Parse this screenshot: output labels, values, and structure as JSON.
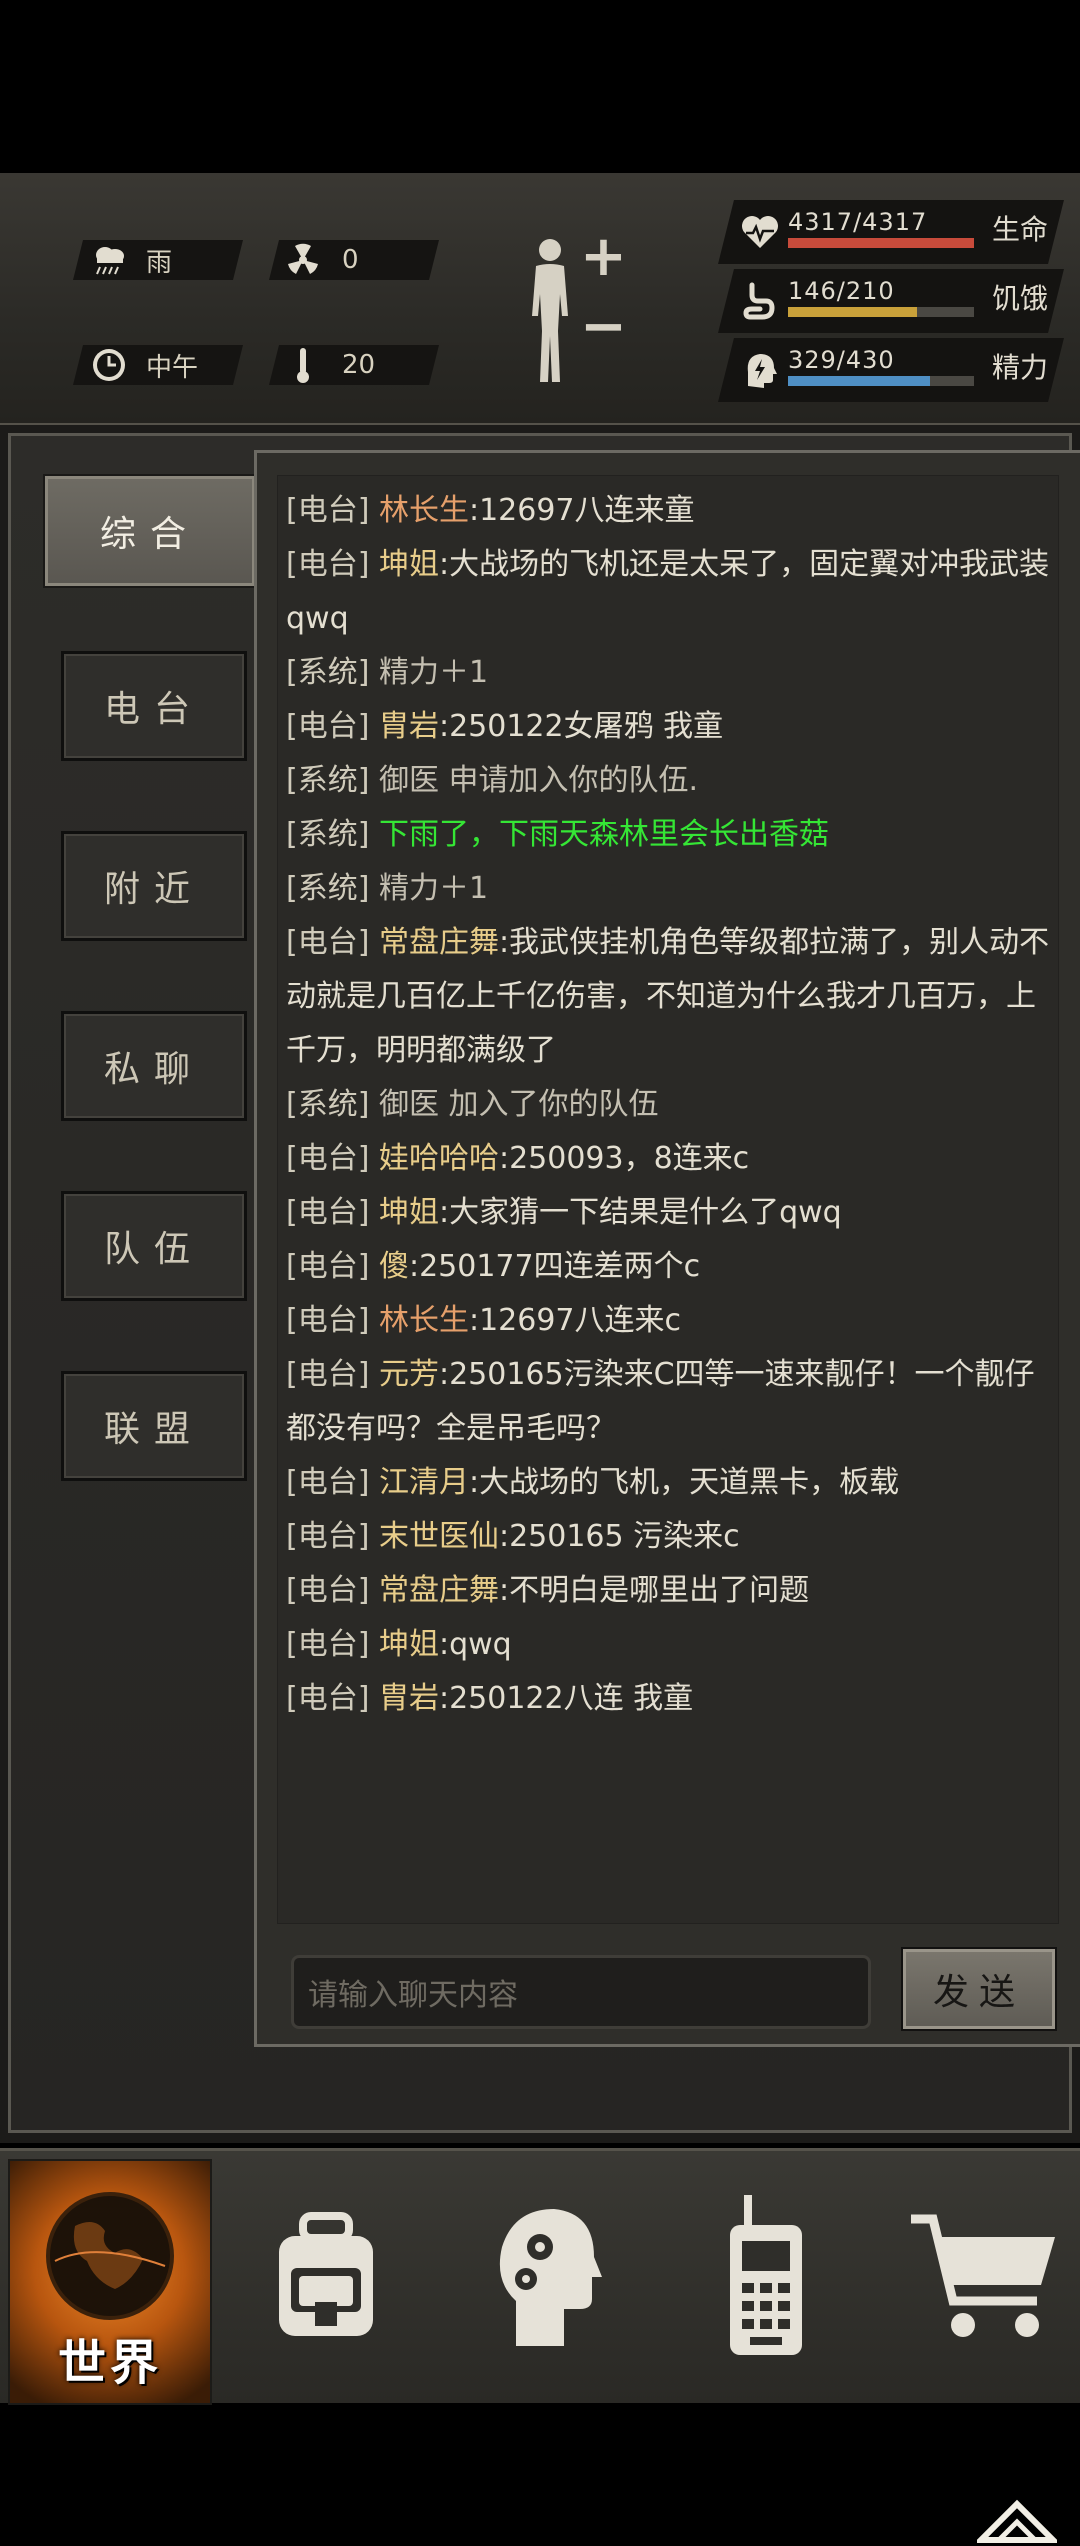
{
  "hud": {
    "weather": {
      "icon": "rain-cloud-icon",
      "label": "雨"
    },
    "radiation": {
      "icon": "radiation-icon",
      "value": "0"
    },
    "time": {
      "icon": "clock-icon",
      "label": "中午"
    },
    "temperature": {
      "icon": "thermometer-icon",
      "value": "20"
    },
    "body": {
      "icon": "body-figure-icon",
      "plus": "+",
      "minus": "−"
    },
    "stats": [
      {
        "name": "health",
        "icon": "heart-pulse-icon",
        "value": "4317/4317",
        "label": "生命",
        "fraction": 1.0,
        "color": "#c84b3b"
      },
      {
        "name": "hunger",
        "icon": "stomach-icon",
        "value": "146/210",
        "label": "饥饿",
        "fraction": 0.695,
        "color": "#c9a13a"
      },
      {
        "name": "energy",
        "icon": "head-bolt-icon",
        "value": "329/430",
        "label": "精力",
        "fraction": 0.765,
        "color": "#4f8fc4"
      }
    ]
  },
  "tabs": [
    {
      "label": "综合",
      "active": true
    },
    {
      "label": "电台",
      "active": false
    },
    {
      "label": "附近",
      "active": false
    },
    {
      "label": "私聊",
      "active": false
    },
    {
      "label": "队伍",
      "active": false
    },
    {
      "label": "联盟",
      "active": false
    }
  ],
  "chat": {
    "messages": [
      {
        "channel": "[电台]",
        "sender": "林长生",
        "sender_color": "orange",
        "text": ":12697八连来童"
      },
      {
        "channel": "[电台]",
        "sender": "坤姐",
        "sender_color": "gold",
        "text": ":大战场的飞机还是太呆了，固定翼对冲我武装qwq"
      },
      {
        "channel": "[系统]",
        "sender": "",
        "sender_color": "",
        "text": "精力＋1"
      },
      {
        "channel": "[电台]",
        "sender": "胄岩",
        "sender_color": "gold",
        "text": ":250122女屠鸦 我童"
      },
      {
        "channel": "[系统]",
        "sender": "",
        "sender_color": "",
        "text": "御医 申请加入你的队伍."
      },
      {
        "channel": "[系统]",
        "sender": "",
        "sender_color": "green",
        "text": "下雨了，下雨天森林里会长出香菇"
      },
      {
        "channel": "[系统]",
        "sender": "",
        "sender_color": "",
        "text": "精力＋1"
      },
      {
        "channel": "[电台]",
        "sender": "常盘庄舞",
        "sender_color": "gold",
        "text": ":我武侠挂机角色等级都拉满了，别人动不动就是几百亿上千亿伤害，不知道为什么我才几百万，上千万，明明都满级了"
      },
      {
        "channel": "[系统]",
        "sender": "",
        "sender_color": "",
        "text": "御医 加入了你的队伍"
      },
      {
        "channel": "[电台]",
        "sender": "娃哈哈哈",
        "sender_color": "gold",
        "text": ":250093，8连来c"
      },
      {
        "channel": "[电台]",
        "sender": "坤姐",
        "sender_color": "gold",
        "text": ":大家猜一下结果是什么了qwq"
      },
      {
        "channel": "[电台]",
        "sender": "傻",
        "sender_color": "gold",
        "text": ":250177四连差两个c"
      },
      {
        "channel": "[电台]",
        "sender": "林长生",
        "sender_color": "orange",
        "text": ":12697八连来c"
      },
      {
        "channel": "[电台]",
        "sender": "元芳",
        "sender_color": "gold",
        "text": ":250165污染来C四等一速来靓仔！一个靓仔都没有吗？全是吊毛吗？"
      },
      {
        "channel": "[电台]",
        "sender": "江清月",
        "sender_color": "gold",
        "text": ":大战场的飞机，天道黑卡，板载"
      },
      {
        "channel": "[电台]",
        "sender": "末世医仙",
        "sender_color": "gold",
        "text": ":250165 污染来c"
      },
      {
        "channel": "[电台]",
        "sender": "常盘庄舞",
        "sender_color": "gold",
        "text": ":不明白是哪里出了问题"
      },
      {
        "channel": "[电台]",
        "sender": "坤姐",
        "sender_color": "gold",
        "text": ":qwq"
      },
      {
        "channel": "[电台]",
        "sender": "胄岩",
        "sender_color": "gold",
        "text": ":250122八连 我童"
      }
    ],
    "input_placeholder": "请输入聊天内容",
    "send_label": "发送"
  },
  "bottom_nav": {
    "world_label": "世界",
    "items": [
      {
        "name": "world",
        "icon": "globe-icon"
      },
      {
        "name": "backpack",
        "icon": "backpack-icon"
      },
      {
        "name": "skills",
        "icon": "head-gears-icon"
      },
      {
        "name": "radio",
        "icon": "walkie-talkie-icon"
      },
      {
        "name": "shop",
        "icon": "shopping-cart-icon"
      }
    ]
  }
}
